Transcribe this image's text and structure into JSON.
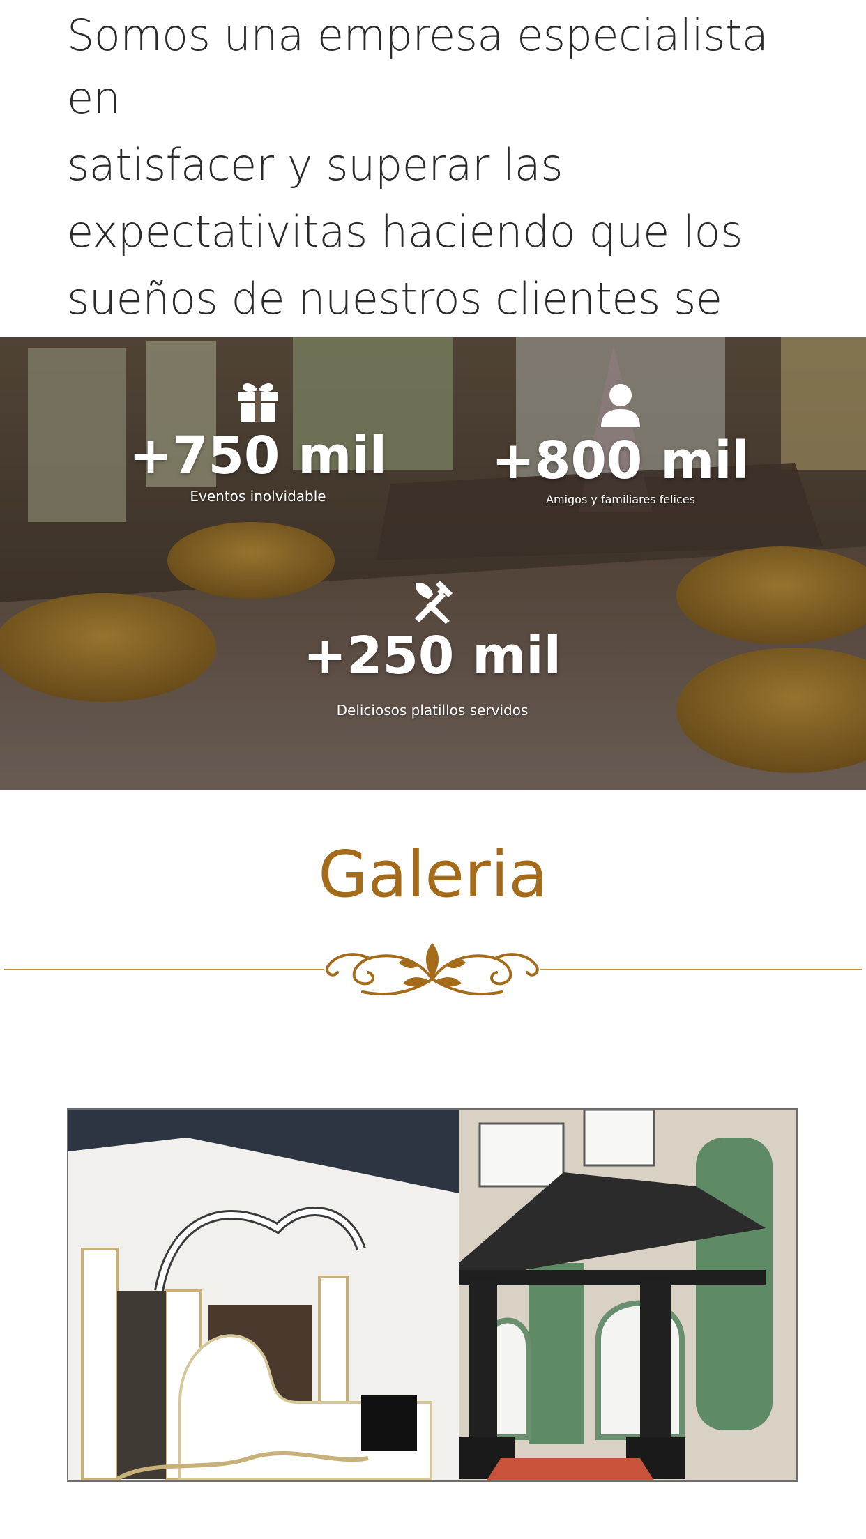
{
  "intro": {
    "lines": [
      "Somos una empresa especialista en",
      "satisfacer y superar las",
      "expectativitas haciendo que los",
      "sueños de nuestros clientes se"
    ]
  },
  "stats": [
    {
      "icon": "gift-icon",
      "value": "+750 mil",
      "label": "Eventos inolvidable"
    },
    {
      "icon": "person-icon",
      "value": "+800 mil",
      "label": "Amigos y familiares felices"
    },
    {
      "icon": "utensils-icon",
      "value": "+250 mil",
      "label": "Deliciosos platillos servidos"
    }
  ],
  "gallery": {
    "title": "Galeria"
  },
  "colors": {
    "accent": "#a46b1b",
    "text": "#2a2a2a"
  }
}
